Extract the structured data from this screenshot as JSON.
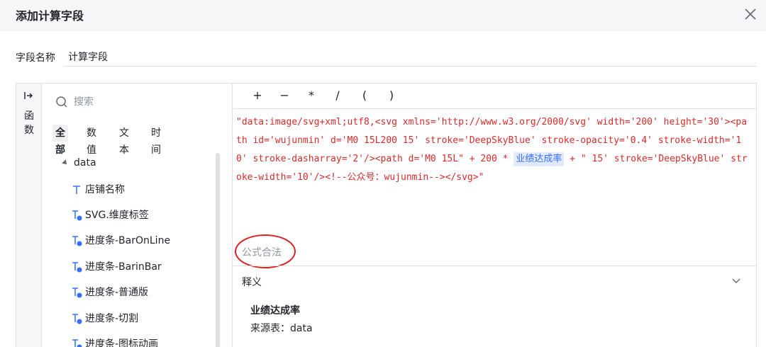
{
  "dialog": {
    "title": "添加计算字段"
  },
  "field_name": {
    "label": "字段名称",
    "value": "计算字段"
  },
  "rail": {
    "label": "函数"
  },
  "fields_panel": {
    "search_placeholder": "搜索",
    "tabs": [
      {
        "label": "全部",
        "active": true
      },
      {
        "label": "数值",
        "active": false
      },
      {
        "label": "文本",
        "active": false
      },
      {
        "label": "时间",
        "active": false
      }
    ],
    "root": "data",
    "items": [
      {
        "label": "店铺名称",
        "icon": "text-type-icon"
      },
      {
        "label": "SVG.维度标签",
        "icon": "calc-text-field-icon"
      },
      {
        "label": "进度条-BarOnLine",
        "icon": "calc-text-field-icon"
      },
      {
        "label": "进度条-BarinBar",
        "icon": "calc-text-field-icon"
      },
      {
        "label": "进度条-普通版",
        "icon": "calc-text-field-icon"
      },
      {
        "label": "进度条-切割",
        "icon": "calc-text-field-icon"
      },
      {
        "label": "进度条-图标动画",
        "icon": "calc-text-field-icon"
      }
    ]
  },
  "editor": {
    "operators": [
      "+",
      "−",
      "*",
      "/",
      "(",
      ")"
    ],
    "formula_before": "\"data:image/svg+xml;utf8,<svg xmlns='http://www.w3.org/2000/svg' width='200' height='30'><path id='wujunmin' d='M0 15L200 15' stroke='DeepSkyBlue' stroke-opacity='0.4' stroke-width='10' stroke-dasharray='2'/><path d='M0 15L\" + 200 * ",
    "formula_chip": "业绩达成率",
    "formula_after": " + \" 15' stroke='DeepSkyBlue' stroke-width='10'/><!--公众号：wujunmin--></svg>\"",
    "validity": "公式合法"
  },
  "explain": {
    "title": "释义",
    "field": "业绩达成率",
    "source": "来源表：data"
  },
  "colors": {
    "formula_text": "#d62b2b",
    "chip_bg": "#e1eaff",
    "chip_text": "#3370ff",
    "annotation_ring": "#e02020"
  }
}
